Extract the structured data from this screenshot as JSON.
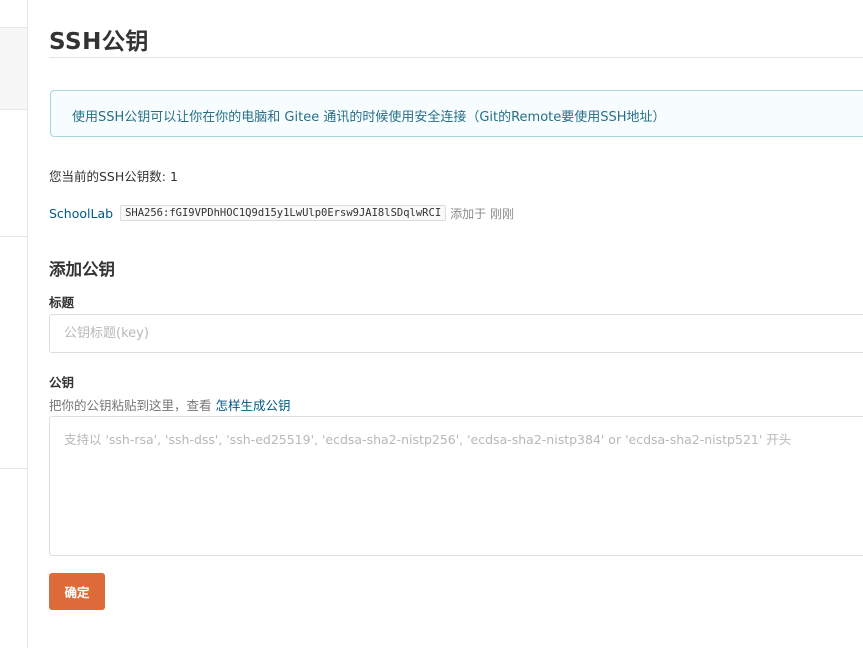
{
  "page": {
    "title": "SSH公钥"
  },
  "info_box": {
    "text": "使用SSH公钥可以让你在你的电脑和 Gitee 通讯的时候使用安全连接（Git的Remote要使用SSH地址）"
  },
  "keys": {
    "count_text": "您当前的SSH公钥数: 1",
    "items": [
      {
        "name": "SchoolLab",
        "fingerprint": "SHA256:fGI9VPDhHOC1Q9d15y1LwUlp0Ersw9JAI8lSDqlwRCI",
        "added": "添加于 刚刚"
      }
    ]
  },
  "add_form": {
    "section_title": "添加公钥",
    "title_label": "标题",
    "title_placeholder": "公钥标题(key)",
    "title_value": "",
    "key_label": "公钥",
    "key_hint": "把你的公钥粘贴到这里，查看 ",
    "key_hint_link": "怎样生成公钥",
    "key_placeholder": "支持以 'ssh-rsa', 'ssh-dss', 'ssh-ed25519', 'ecdsa-sha2-nistp256', 'ecdsa-sha2-nistp384' or 'ecdsa-sha2-nistp521' 开头",
    "key_value": "",
    "submit_label": "确定"
  },
  "colors": {
    "accent_button": "#dd6a39",
    "link": "#005980",
    "info_bg": "#f7fdfe",
    "info_border": "#a9d5de",
    "info_text": "#276f86"
  }
}
